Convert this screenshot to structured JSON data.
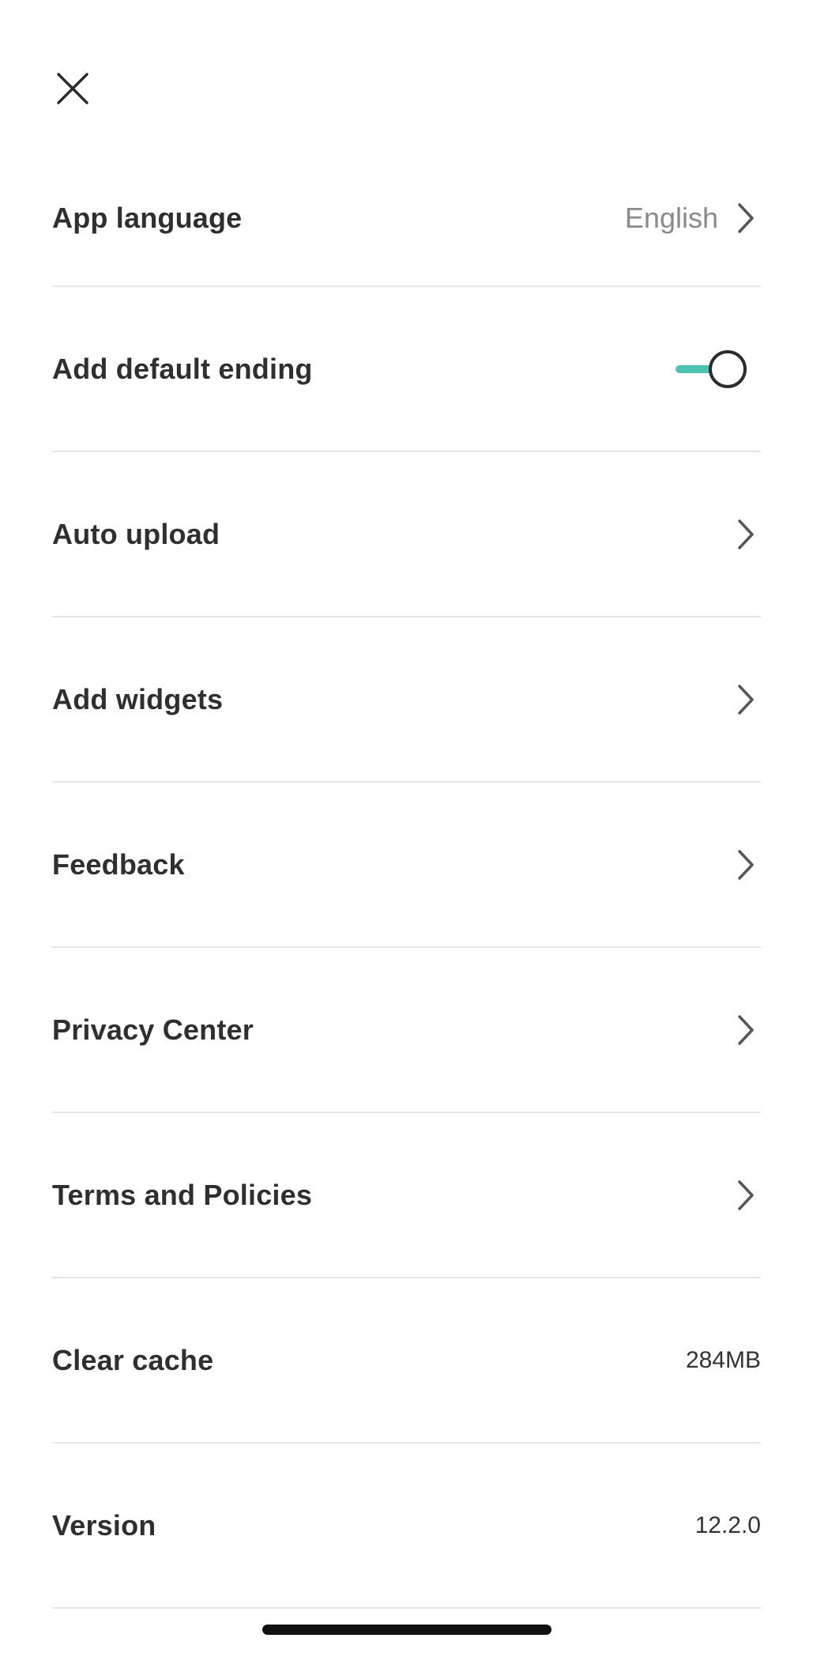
{
  "header": {
    "close_icon": "close-icon"
  },
  "colors": {
    "accent": "#4cc2b0",
    "divider": "#e6e6e6",
    "text_primary": "#2f2f2f",
    "text_secondary": "#8a8a8a"
  },
  "settings": {
    "app_language": {
      "label": "App language",
      "value": "English",
      "icon": "chevron-right-icon"
    },
    "add_default_ending": {
      "label": "Add default ending",
      "toggle_on": true
    },
    "auto_upload": {
      "label": "Auto upload",
      "icon": "chevron-right-icon"
    },
    "add_widgets": {
      "label": "Add widgets",
      "icon": "chevron-right-icon"
    },
    "feedback": {
      "label": "Feedback",
      "icon": "chevron-right-icon"
    },
    "privacy_center": {
      "label": "Privacy Center",
      "icon": "chevron-right-icon"
    },
    "terms_and_policies": {
      "label": "Terms and Policies",
      "icon": "chevron-right-icon"
    },
    "clear_cache": {
      "label": "Clear cache",
      "value": "284MB"
    },
    "version": {
      "label": "Version",
      "value": "12.2.0"
    }
  }
}
